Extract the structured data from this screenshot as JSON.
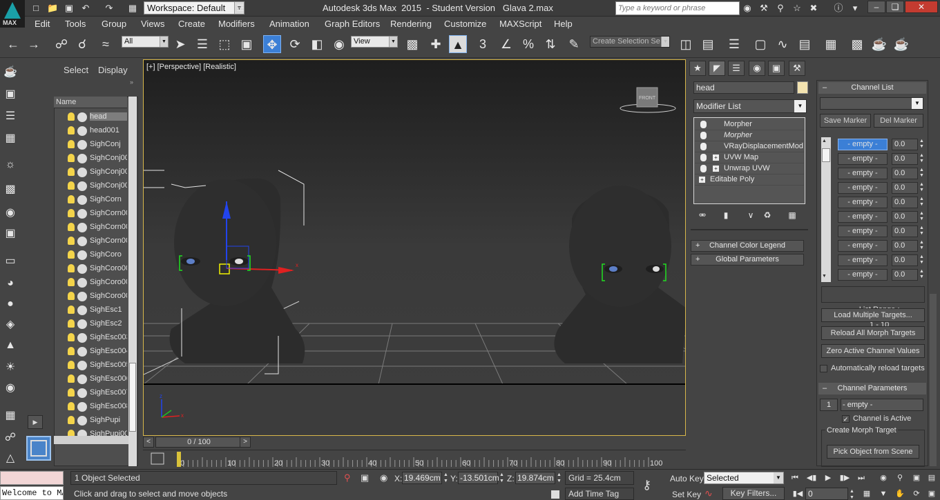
{
  "titlebar": {
    "workspace": "Workspace: Default",
    "title": "Autodesk 3ds Max  2015  - Student Version   Glava 2.max",
    "search_placeholder": "Type a keyword or phrase",
    "logo_label": "MAX"
  },
  "menu": [
    "Edit",
    "Tools",
    "Group",
    "Views",
    "Create",
    "Modifiers",
    "Animation",
    "Graph Editors",
    "Rendering",
    "Customize",
    "MAXScript",
    "Help"
  ],
  "toolbar": {
    "filter_combo": "All",
    "ref_coord_combo": "View",
    "selection_set_combo": "Create Selection Se",
    "snap_label": "3"
  },
  "scene_explorer": {
    "tabs": [
      "Select",
      "Display"
    ],
    "column_header": "Name",
    "objects": [
      "head",
      "head001",
      "SighConj",
      "SighConj00",
      "SighConj00",
      "SighConj00",
      "SighCorn",
      "SighCorn00",
      "SighCorn00",
      "SighCorn00",
      "SighCoro",
      "SighCoro00",
      "SighCoro00",
      "SighCoro00",
      "SighEsc1",
      "SighEsc2",
      "SighEsc003",
      "SighEsc004",
      "SighEsc005",
      "SighEsc006",
      "SighEsc007",
      "SighEsc008",
      "SighPupi",
      "SighPupi00"
    ]
  },
  "viewport": {
    "label": "[+] [Perspective] [Realistic]",
    "viewcube_face": "FRONT"
  },
  "command_panel": {
    "object_name": "head",
    "object_color": "#f3e3b0",
    "modifier_list": "Modifier List",
    "stack": [
      {
        "name": "Morpher",
        "italic": false,
        "expand": false
      },
      {
        "name": "Morpher",
        "italic": true,
        "expand": false
      },
      {
        "name": "VRayDisplacementMod",
        "italic": false,
        "expand": false
      },
      {
        "name": "UVW Map",
        "italic": false,
        "expand": true
      },
      {
        "name": "Unwrap UVW",
        "italic": false,
        "expand": true
      },
      {
        "name": "Editable Poly",
        "italic": false,
        "expand": true,
        "base": true
      }
    ],
    "rollouts": {
      "channel_color_legend": "Channel Color Legend",
      "global_parameters": "Global Parameters"
    },
    "channel_list": {
      "title": "Channel List",
      "save_marker": "Save Marker",
      "del_marker": "Del Marker",
      "channels": [
        {
          "name": "- empty -",
          "value": "0.0"
        },
        {
          "name": "- empty -",
          "value": "0.0"
        },
        {
          "name": "- empty -",
          "value": "0.0"
        },
        {
          "name": "- empty -",
          "value": "0.0"
        },
        {
          "name": "- empty -",
          "value": "0.0"
        },
        {
          "name": "- empty -",
          "value": "0.0"
        },
        {
          "name": "- empty -",
          "value": "0.0"
        },
        {
          "name": "- empty -",
          "value": "0.0"
        },
        {
          "name": "- empty -",
          "value": "0.0"
        },
        {
          "name": "- empty -",
          "value": "0.0"
        }
      ],
      "list_range_label": "List Range :",
      "list_range_value": "1 - 10",
      "load_multiple": "Load Multiple Targets...",
      "reload_all": "Reload All Morph Targets",
      "zero_active": "Zero Active Channel Values",
      "auto_reload": "Automatically reload targets"
    },
    "channel_parameters": {
      "title": "Channel Parameters",
      "channel_number": "1",
      "channel_name": "- empty -",
      "channel_active": "Channel is Active",
      "create_group": "Create Morph Target",
      "pick_button": "Pick Object from Scene"
    }
  },
  "timeline": {
    "slider_label": "0 / 100",
    "ticks": [
      "0",
      "10",
      "20",
      "30",
      "40",
      "50",
      "60",
      "70",
      "80",
      "90",
      "100"
    ]
  },
  "status": {
    "listener_text": "Welcome to MAXScript.",
    "selection": "1 Object Selected",
    "prompt": "Click and drag to select and move objects",
    "x_label": "X:",
    "x_value": "19.469cm",
    "y_label": "Y:",
    "y_value": "-13.501cm",
    "z_label": "Z:",
    "z_value": "19.874cm",
    "grid": "Grid = 25.4cm",
    "add_time_tag": "Add Time Tag",
    "auto_key": "Auto Key",
    "set_key": "Set Key",
    "selected_combo": "Selected",
    "key_filters": "Key Filters...",
    "frame": "0"
  }
}
